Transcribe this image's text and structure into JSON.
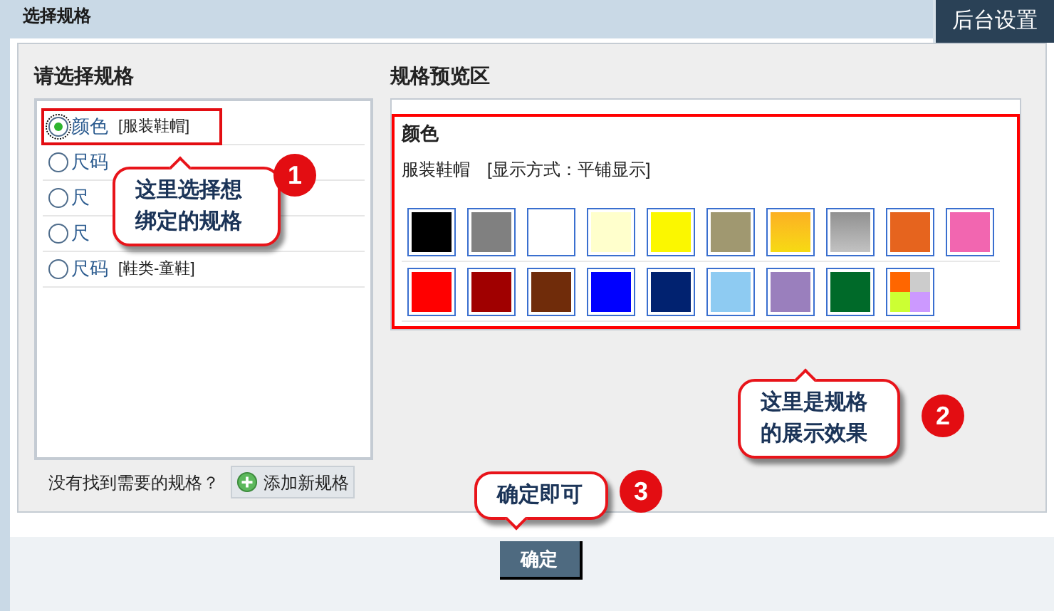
{
  "header": {
    "title": "选择规格",
    "corner_button": "后台设置"
  },
  "left": {
    "heading": "请选择规格",
    "items": [
      {
        "name": "颜色",
        "tag": "[服装鞋帽]",
        "selected": true
      },
      {
        "name": "尺码",
        "selected": false
      },
      {
        "name": "尺",
        "selected": false
      },
      {
        "name": "尺",
        "selected": false
      },
      {
        "name": "尺码",
        "tag": "[鞋类-童鞋]",
        "selected": false
      }
    ],
    "not_found": "没有找到需要的规格？",
    "add_button": "添加新规格"
  },
  "preview": {
    "heading": "规格预览区",
    "spec_title": "颜色",
    "spec_desc": "服装鞋帽　[显示方式：平铺显示]",
    "swatches": [
      {
        "kind": "solid",
        "color": "#000000"
      },
      {
        "kind": "solid",
        "color": "#808080"
      },
      {
        "kind": "solid",
        "color": "#ffffff"
      },
      {
        "kind": "solid",
        "color": "#ffffcc"
      },
      {
        "kind": "solid",
        "color": "#fbf700"
      },
      {
        "kind": "solid",
        "color": "#a09870"
      },
      {
        "kind": "gradient",
        "color": "#fcb022"
      },
      {
        "kind": "gradient",
        "color": "#919191"
      },
      {
        "kind": "solid",
        "color": "#e6641e"
      },
      {
        "kind": "solid",
        "color": "#f266b0"
      },
      {
        "kind": "solid",
        "color": "#ff0000"
      },
      {
        "kind": "solid",
        "color": "#a00000"
      },
      {
        "kind": "solid",
        "color": "#702c0a"
      },
      {
        "kind": "solid",
        "color": "#0000ff"
      },
      {
        "kind": "solid",
        "color": "#012270"
      },
      {
        "kind": "solid",
        "color": "#8ecbf2"
      },
      {
        "kind": "solid",
        "color": "#9a7fbd"
      },
      {
        "kind": "solid",
        "color": "#006a29"
      },
      {
        "kind": "multi"
      }
    ]
  },
  "callouts": [
    {
      "text": "这里选择想绑定的规格",
      "number": "1"
    },
    {
      "text": "这里是规格的展示效果",
      "number": "2"
    },
    {
      "text": "确定即可",
      "number": "3"
    }
  ],
  "confirm_button": "确定"
}
